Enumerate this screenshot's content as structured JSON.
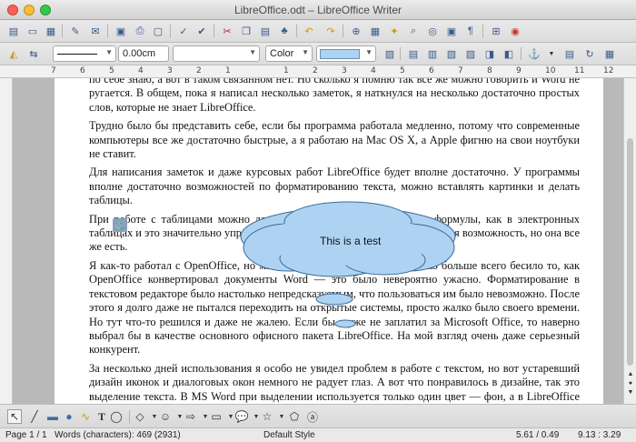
{
  "window": {
    "title": "LibreOffice.odt – LibreOffice Writer"
  },
  "toolbar_line": {
    "width_value": "0.00cm",
    "color_label": "Color"
  },
  "ruler": {
    "ticks": [
      "7",
      "6",
      "5",
      "4",
      "3",
      "2",
      "1",
      "",
      "1",
      "2",
      "3",
      "4",
      "5",
      "6",
      "7",
      "8",
      "9",
      "10",
      "11",
      "12"
    ]
  },
  "document": {
    "paragraphs": [
      "по себе знаю, а вот в таком связанном нет. Но сколько я помню так все же можно говорить и Word не ругается. В общем, пока я написал несколько заметок, я наткнулся на несколько достаточно простых слов, которые не знает LibreOffice.",
      "Трудно было бы представить себе, если бы программа работала медленно, потому что современные компьютеры все же достаточно быстрые, а я работаю на Mac OS X, а Apple фигню на свои ноутбуки не ставит.",
      "Для написания заметок и даже курсовых работ LibreOffice будет вполне достаточно. У программы вполне достаточно возможностей по форматированию текста, можно вставлять картинки и делать таблицы.",
      "При работе с таблицами можно даже использовать математические формулы, как в электронных таблицах и это значительно упрощает работу с ними. Но это уж необходимая возможность, но она все же есть.",
      "Я как-то работал с OpenOffice, но мне он сразу не понравился. Однако больше всего бесило то, как OpenOffice конвертировал документы Word — это было невероятно ужасно. Форматирование в текстовом редакторе было настолько непредсказуемым, что пользоваться им было невозможно. После этого я долго даже не пытался переходить на открытые системы, просто жалко было своего времени. Но тут что-то решился и даже не жалею. Если бы я уже не заплатил за Microsoft Office, то наверно выбрал бы в качестве основного офисного пакета LibreOffice. На мой взгляд очень даже серьезный конкурент.",
      "За несколько дней использования я особо не увидел проблем в работе с текстом, но вот устаревший дизайн иконок и диалоговых окон немного не радует глаз. А вот что понравилось в дизайне, так это выделение текста. В MS Word при выделении используется только один цвет — фон, а в LibreOffice не только фон, но и еще и бурдюрчик. Вроде бы простая вещь, а симпатичная."
    ],
    "shape_text": "This is a test"
  },
  "statusbar": {
    "page": "Page 1 / 1",
    "words": "Words (characters): 469 (2931)",
    "style": "Default Style",
    "position": "5.61 / 0.49",
    "size": "9.13 : 3.29"
  },
  "colors": {
    "cloud_fill": "#aed3f2",
    "cloud_stroke": "#3a6a96"
  }
}
